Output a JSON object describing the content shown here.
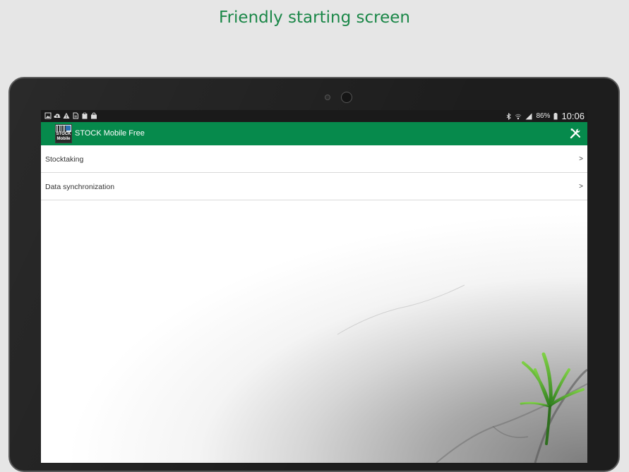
{
  "headline": "Friendly starting screen",
  "status_bar": {
    "left_icons": [
      "gallery-icon",
      "upload-cloud-icon",
      "warning-icon",
      "document-icon",
      "clipboard-icon",
      "shopping-bag-icon"
    ],
    "battery": "86%",
    "time": "10:06"
  },
  "app": {
    "logo_text": "STOCK Mobile",
    "title": "STOCK Mobile Free"
  },
  "menu": [
    {
      "label": "Stocktaking",
      "chevron": ">"
    },
    {
      "label": "Data synchronization",
      "chevron": ">"
    }
  ],
  "colors": {
    "accent": "#068a4c",
    "headline": "#1b8748",
    "bezel": "#1d1d1d"
  }
}
